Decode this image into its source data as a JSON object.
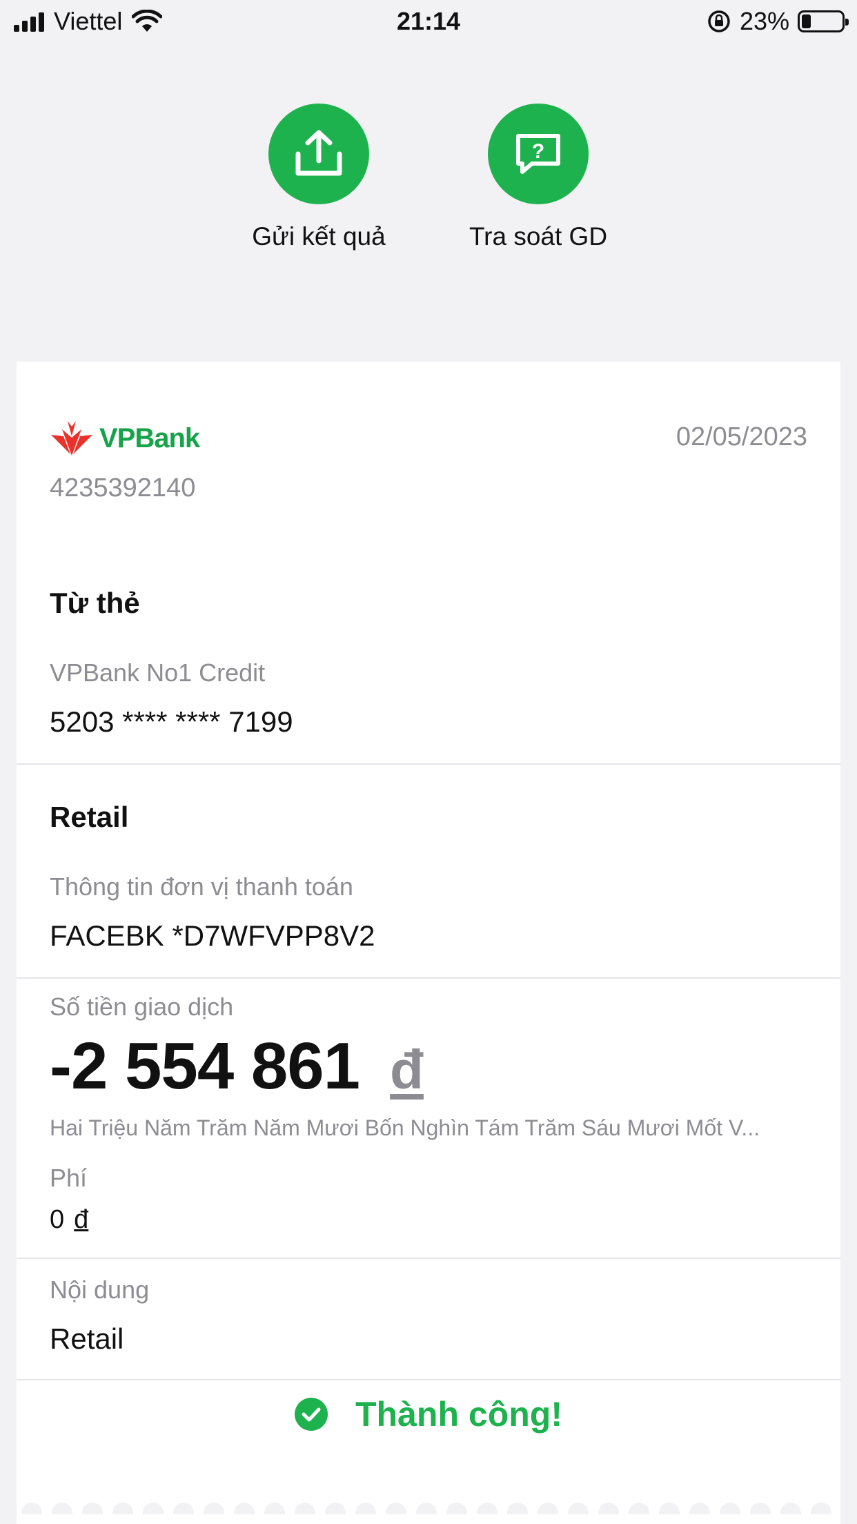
{
  "status_bar": {
    "carrier": "Viettel",
    "time": "21:14",
    "battery_percent": "23%",
    "battery_level": 0.23
  },
  "actions": [
    {
      "label": "Gửi kết quả",
      "icon": "share-upload-icon"
    },
    {
      "label": "Tra soát GD",
      "icon": "question-chat-icon"
    }
  ],
  "receipt": {
    "bank_name": "VPBank",
    "date": "02/05/2023",
    "transaction_id": "4235392140",
    "from_card": {
      "title": "Từ thẻ",
      "card_name": "VPBank No1 Credit",
      "card_number": "5203 **** **** 7199"
    },
    "merchant": {
      "title": "Retail",
      "label": "Thông tin đơn vị thanh toán",
      "value": "FACEBK *D7WFVPP8V2"
    },
    "amount": {
      "label": "Số tiền giao dịch",
      "value": "-2 554 861",
      "currency": "đ",
      "in_words": "Hai Triệu Năm Trăm Năm Mươi Bốn Nghìn Tám Trăm Sáu Mươi Mốt V..."
    },
    "fee": {
      "label": "Phí",
      "value": "0",
      "currency": "đ"
    },
    "content": {
      "label": "Nội dung",
      "value": "Retail"
    },
    "status": "Thành công!"
  },
  "colors": {
    "accent": "#1eb24f",
    "muted": "#8c8c92",
    "logo_red": "#e8322b"
  }
}
